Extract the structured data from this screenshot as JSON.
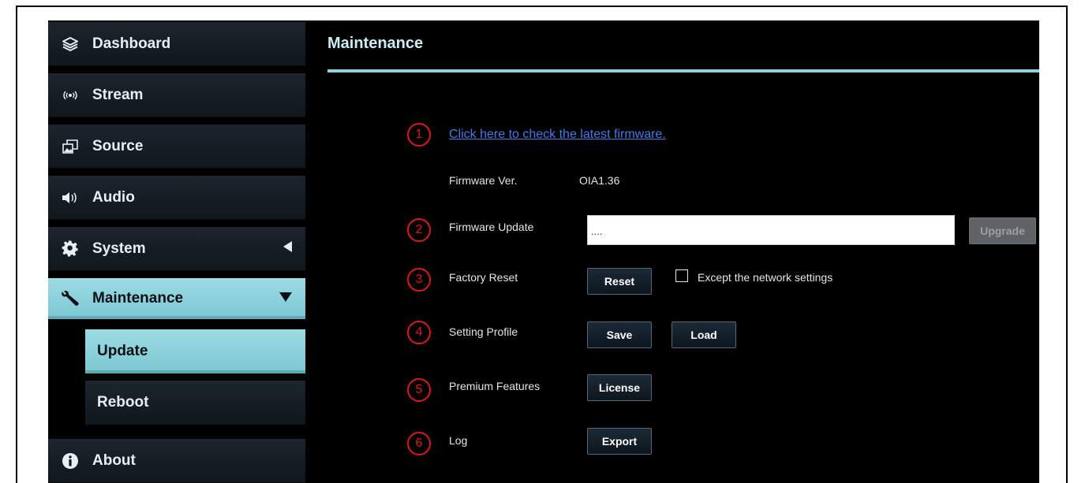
{
  "sidebar": {
    "items": [
      {
        "label": "Dashboard",
        "icon": "layers-icon"
      },
      {
        "label": "Stream",
        "icon": "broadcast-icon"
      },
      {
        "label": "Source",
        "icon": "source-icon"
      },
      {
        "label": "Audio",
        "icon": "speaker-icon"
      },
      {
        "label": "System",
        "icon": "gear-icon"
      },
      {
        "label": "Maintenance",
        "icon": "wrench-icon"
      }
    ],
    "sub_items": [
      {
        "label": "Update"
      },
      {
        "label": "Reboot"
      }
    ],
    "about": {
      "label": "About",
      "icon": "info-icon"
    }
  },
  "main": {
    "title": "Maintenance",
    "markers": [
      "1",
      "2",
      "3",
      "4",
      "5",
      "6"
    ],
    "firmware_link": "Click here to check the latest firmware.",
    "firmware_ver_label": "Firmware Ver.",
    "firmware_ver_value": "OIA1.36",
    "firmware_update_label": "Firmware Update",
    "firmware_file_value": "....",
    "upgrade_label": "Upgrade",
    "factory_reset_label": "Factory Reset",
    "reset_label": "Reset",
    "except_network_label": "Except the network settings",
    "setting_profile_label": "Setting Profile",
    "save_label": "Save",
    "load_label": "Load",
    "premium_features_label": "Premium Features",
    "license_label": "License",
    "log_label": "Log",
    "export_label": "Export"
  },
  "colors": {
    "accent": "#8fd3dd",
    "active_nav": "#9bdbe4",
    "link": "#3b7df0",
    "marker": "#e0161a"
  }
}
